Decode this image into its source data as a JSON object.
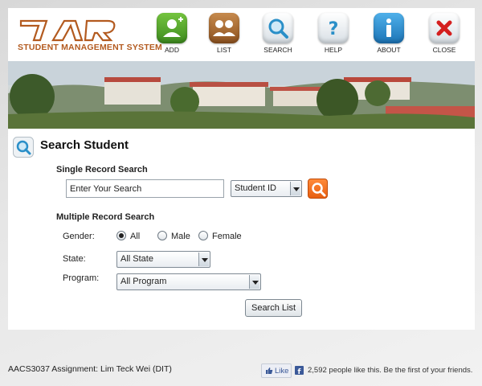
{
  "logo": {
    "letters": "TAR",
    "subtitle": "STUDENT MANAGEMENT SYSTEM"
  },
  "nav": [
    {
      "key": "add",
      "label": "ADD",
      "color": "#4fa62a"
    },
    {
      "key": "list",
      "label": "LIST",
      "color": "#a86a34"
    },
    {
      "key": "search",
      "label": "SEARCH",
      "color": "#e9eef2"
    },
    {
      "key": "help",
      "label": "HELP",
      "color": "#eef1f4"
    },
    {
      "key": "about",
      "label": "ABOUT",
      "color": "#2b8fd4"
    },
    {
      "key": "close",
      "label": "CLOSE",
      "color": "#eef1f4"
    }
  ],
  "page": {
    "title": "Search Student"
  },
  "single": {
    "heading": "Single Record Search",
    "input_value": "Enter Your Search",
    "field_select": "Student ID"
  },
  "multiple": {
    "heading": "Multiple Record Search",
    "gender_label": "Gender:",
    "gender_options": [
      "All",
      "Male",
      "Female"
    ],
    "gender_selected": "All",
    "state_label": "State:",
    "state_value": "All State",
    "program_label": "Program:",
    "program_value": "All Program",
    "search_list_label": "Search List"
  },
  "footer": {
    "assignment": "AACS3037 Assignment: Lim Teck Wei (DIT)",
    "like_label": "Like",
    "fb_text": "2,592 people like this. Be the first of your friends."
  },
  "colors": {
    "accent_orange": "#f07020",
    "brand_brown": "#b35a1f",
    "fb_blue": "#3b5998"
  }
}
